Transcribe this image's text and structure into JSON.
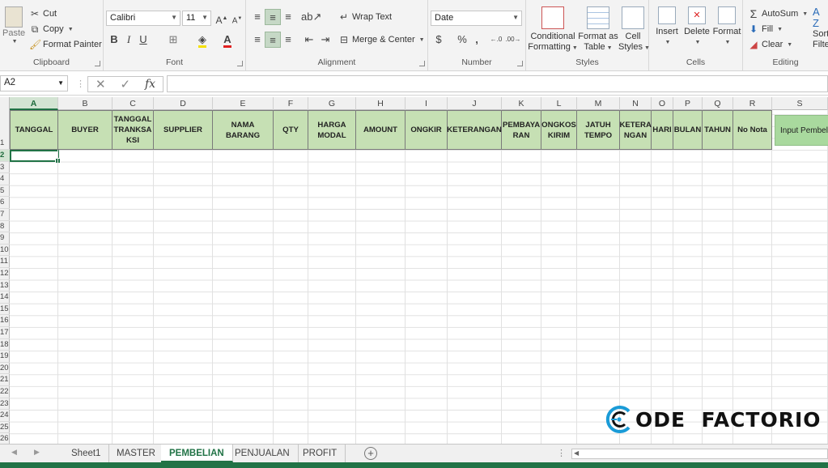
{
  "ribbon": {
    "clipboard": {
      "paste": "Paste",
      "cut": "Cut",
      "copy": "Copy",
      "format_painter": "Format Painter",
      "label": "Clipboard"
    },
    "font": {
      "name": "Calibri",
      "size": "11",
      "bold": "B",
      "italic": "I",
      "underline": "U",
      "grow": "A",
      "shrink": "A",
      "label": "Font"
    },
    "alignment": {
      "wrap_text": "Wrap Text",
      "merge_center": "Merge & Center",
      "label": "Alignment"
    },
    "number": {
      "format": "Date",
      "currency": "$",
      "percent": "%",
      "comma": ",",
      "label": "Number"
    },
    "styles": {
      "conditional": [
        "Conditional",
        "Formatting"
      ],
      "format_table": [
        "Format as",
        "Table"
      ],
      "cell_styles": [
        "Cell",
        "Styles"
      ],
      "label": "Styles"
    },
    "cells": {
      "insert": "Insert",
      "delete": "Delete",
      "format": "Format",
      "label": "Cells"
    },
    "editing": {
      "autosum": "AutoSum",
      "fill": "Fill",
      "clear": "Clear",
      "sort": [
        "Sort",
        "Filte"
      ],
      "label": "Editing"
    }
  },
  "formula_bar": {
    "name_box": "A2",
    "fx": "fx",
    "formula": ""
  },
  "columns": [
    "A",
    "B",
    "C",
    "D",
    "E",
    "F",
    "G",
    "H",
    "I",
    "J",
    "K",
    "L",
    "M",
    "N",
    "O",
    "P",
    "Q",
    "R",
    "S"
  ],
  "selected_column": "A",
  "rows": [
    "1",
    "2",
    "3",
    "4",
    "5",
    "6",
    "7",
    "8",
    "9",
    "10",
    "11",
    "12",
    "13",
    "14",
    "15",
    "16",
    "17",
    "18",
    "19",
    "20",
    "21",
    "22",
    "23",
    "24",
    "25",
    "26"
  ],
  "selected_row": "2",
  "headers": [
    "TANGGAL",
    "BUYER",
    "TANGGAL TRANKSA KSI",
    "SUPPLIER",
    "NAMA BARANG",
    "QTY",
    "HARGA MODAL",
    "AMOUNT",
    "ONGKIR",
    "KETERANGAN",
    "PEMBAYA RAN",
    "ONGKOS KIRIM",
    "JATUH TEMPO",
    "KETERA NGAN",
    "HARI",
    "BULAN",
    "TAHUN",
    "No Nota"
  ],
  "input_button": "Input Pembel",
  "sheet_tabs": [
    {
      "name": "Sheet1",
      "active": false
    },
    {
      "name": "MASTER",
      "active": false
    },
    {
      "name": "PEMBELIAN",
      "active": true
    },
    {
      "name": "PENJUALAN",
      "active": false
    },
    {
      "name": "PROFIT",
      "active": false
    }
  ],
  "watermark": {
    "text": "ODE  FACTORIO"
  },
  "colors": {
    "header_fill": "#c6e0b4",
    "button_fill": "#a9d99e",
    "excel_green": "#217346"
  }
}
